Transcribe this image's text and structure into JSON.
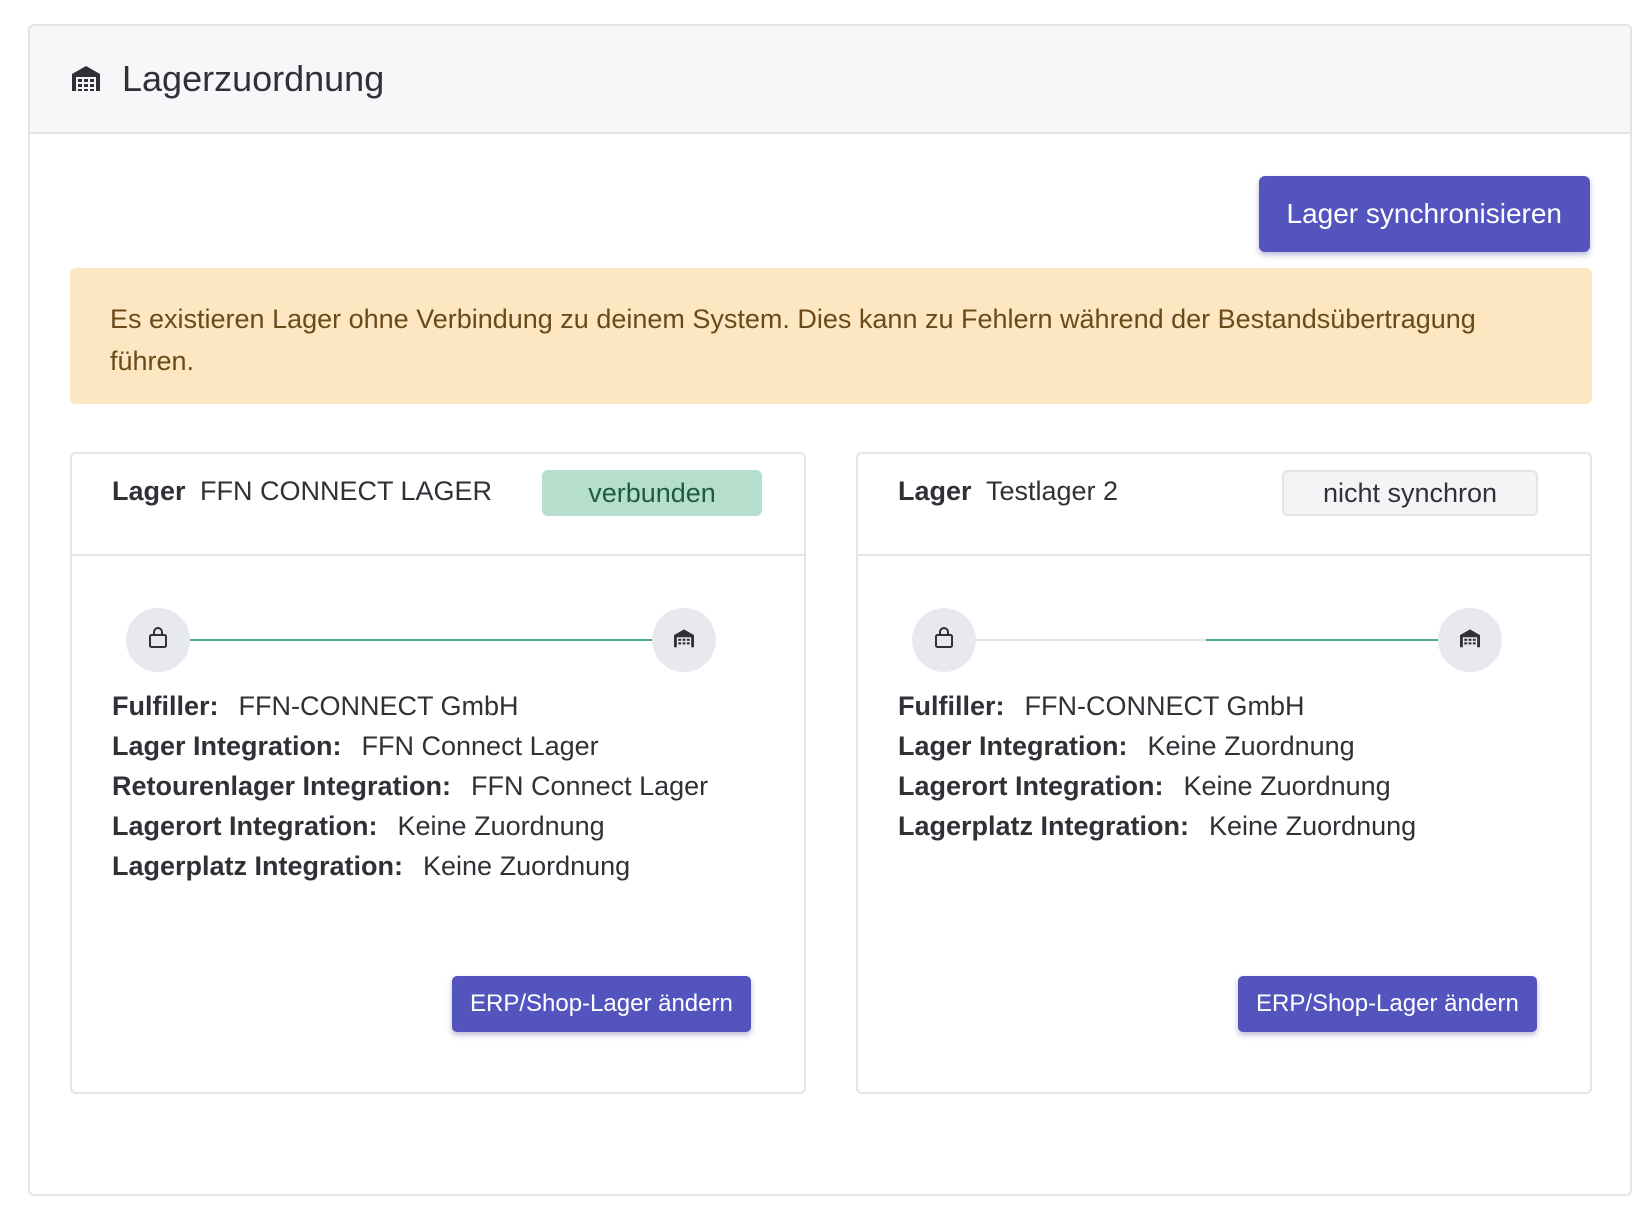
{
  "header": {
    "title": "Lagerzuordnung",
    "icon": "warehouse-icon"
  },
  "sync_button": {
    "label": "Lager synchronisieren"
  },
  "alert": {
    "text": "Es existieren Lager ohne Verbindung zu deinem System. Dies kann zu Fehlern während der Bestandsübertragung führen."
  },
  "colors": {
    "primary": "#5354be",
    "success_line": "#4fae84",
    "alert_bg": "#fde6c2",
    "badge_connected_bg": "#b5dfcc"
  },
  "cards": [
    {
      "label": "Lager",
      "name": "FFN CONNECT LAGER",
      "status": "verbunden",
      "status_type": "connected",
      "start_icon": "shopping-bag-icon",
      "end_icon": "warehouse-icon",
      "connection": "full",
      "details": [
        {
          "key": "Fulfiller:",
          "value": "FFN-CONNECT GmbH"
        },
        {
          "key": "Lager Integration:",
          "value": "FFN Connect Lager"
        },
        {
          "key": "Retourenlager Integration:",
          "value": "FFN Connect Lager"
        },
        {
          "key": "Lagerort Integration:",
          "value": "Keine Zuordnung"
        },
        {
          "key": "Lagerplatz Integration:",
          "value": "Keine Zuordnung"
        }
      ],
      "button_label": "ERP/Shop-Lager ändern"
    },
    {
      "label": "Lager",
      "name": "Testlager 2",
      "status": "nicht synchron",
      "status_type": "unsynced",
      "start_icon": "shopping-bag-icon",
      "end_icon": "warehouse-icon",
      "connection": "partial",
      "details": [
        {
          "key": "Fulfiller:",
          "value": "FFN-CONNECT GmbH"
        },
        {
          "key": "Lager Integration:",
          "value": "Keine Zuordnung"
        },
        {
          "key": "Lagerort Integration:",
          "value": "Keine Zuordnung"
        },
        {
          "key": "Lagerplatz Integration:",
          "value": "Keine Zuordnung"
        }
      ],
      "button_label": "ERP/Shop-Lager ändern"
    }
  ]
}
